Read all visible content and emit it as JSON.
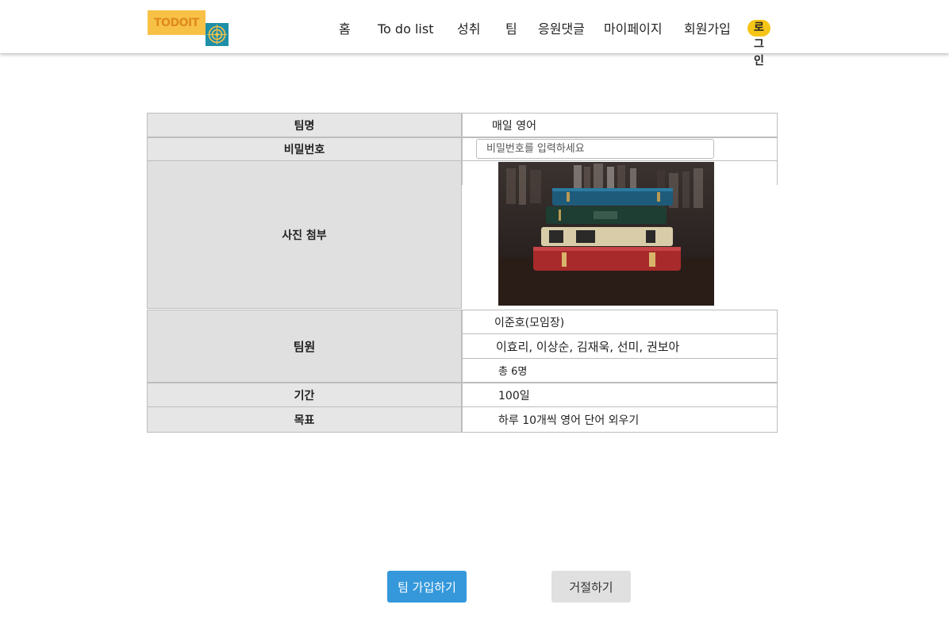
{
  "logo": {
    "text": "TODOIT",
    "icon": "target-icon"
  },
  "nav": {
    "items": [
      "홈",
      "To do list",
      "성취",
      "팀",
      "응원댓글",
      "마이페이지",
      "회원가입"
    ],
    "login": "로그인"
  },
  "team": {
    "name_label": "팀명",
    "name_value": "매일 영어",
    "password_label": "비밀번호",
    "password_placeholder": "비밀번호를 입력하세요",
    "photo_label": "사진 첨부",
    "members_label": "팀원",
    "leader": "이준호(모임장)",
    "members": "이효리, 이상순, 김재욱, 선미, 권보아",
    "total": "총 6명",
    "period_label": "기간",
    "period_value": "100일",
    "goal_label": "목표",
    "goal_value": "하루 10개씩 영어 단어 외우기"
  },
  "actions": {
    "join": "팀 가입하기",
    "reject": "거절하기"
  },
  "colors": {
    "accent": "#3498db",
    "login_badge": "#f5c518",
    "logo_yellow": "#f7c146",
    "logo_teal": "#1e8fa8"
  }
}
